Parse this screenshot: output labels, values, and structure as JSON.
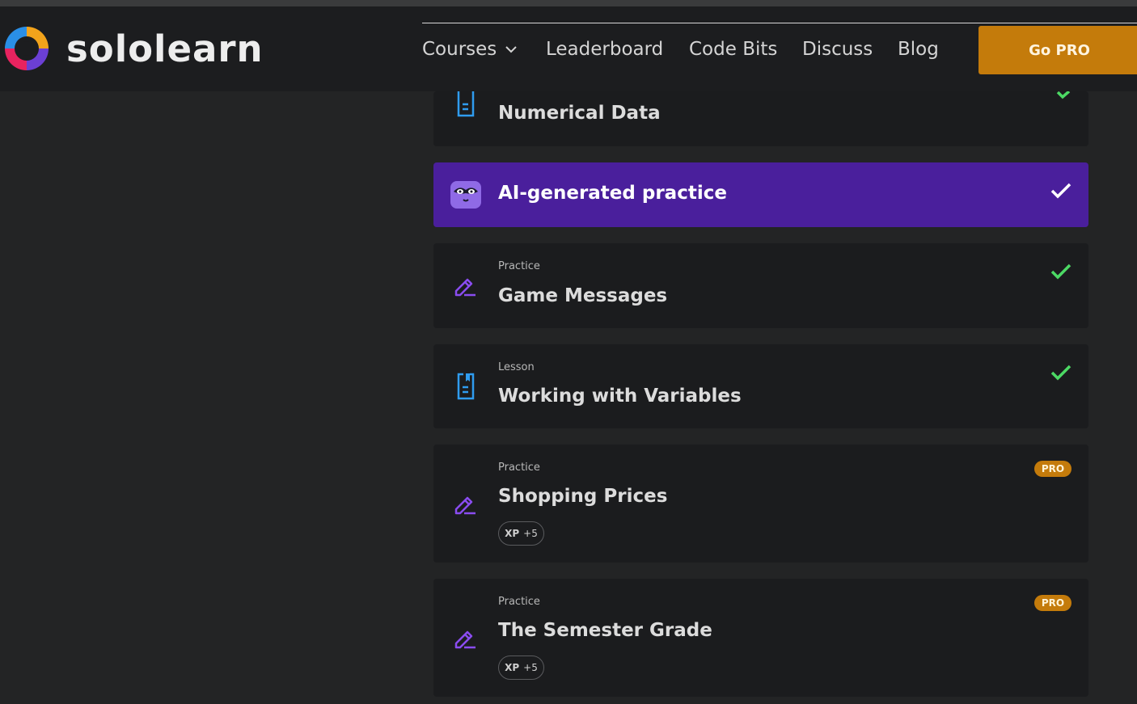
{
  "header": {
    "logo_text": "sololearn",
    "nav": [
      {
        "label": "Courses",
        "has_dropdown": true
      },
      {
        "label": "Leaderboard"
      },
      {
        "label": "Code Bits"
      },
      {
        "label": "Discuss"
      },
      {
        "label": "Blog"
      }
    ],
    "go_pro_label": "Go PRO"
  },
  "colors": {
    "accent_pro": "#c47b0b",
    "ai_card": "#4a1f9c",
    "check_green": "#4cd964",
    "lesson_icon": "#2f9cf0",
    "practice_icon": "#8a4cf0"
  },
  "items": [
    {
      "kind": "",
      "title": "Numerical Data",
      "icon": "lesson-document-icon",
      "completed": true
    },
    {
      "kind": "",
      "title": "AI-generated practice",
      "icon": "ai-robot-icon",
      "completed": true
    },
    {
      "kind": "Practice",
      "title": "Game Messages",
      "icon": "practice-pencil-icon",
      "completed": true
    },
    {
      "kind": "Lesson",
      "title": "Working with Variables",
      "icon": "lesson-document-icon",
      "completed": true
    },
    {
      "kind": "Practice",
      "title": "Shopping Prices",
      "icon": "practice-pencil-icon",
      "pro_badge": "PRO",
      "xp_label": "XP",
      "xp_value": "+5"
    },
    {
      "kind": "Practice",
      "title": "The Semester Grade",
      "icon": "practice-pencil-icon",
      "pro_badge": "PRO",
      "xp_label": "XP",
      "xp_value": "+5"
    }
  ]
}
